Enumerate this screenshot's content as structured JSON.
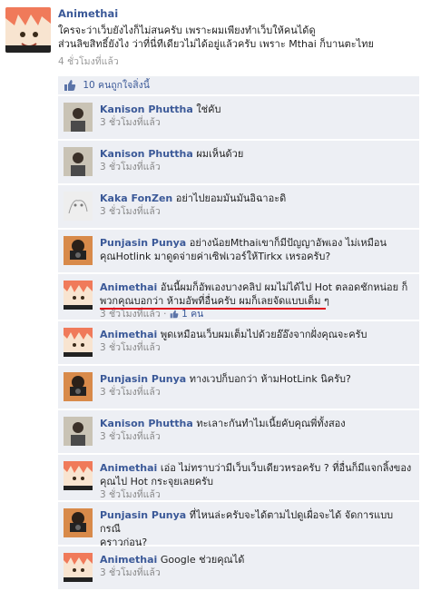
{
  "post": {
    "author": "Animethai",
    "text_line1": "ใครจะว่าเว็บยังไงก็ไม่สนครับ เพราะผมเพียงทำเว็บให้คนได้ดู",
    "text_line2": "ส่วนลิขสิทธิ์ยังไง ว่าที่นี่ทีเดียวไม่ได้อยู่แล้วครับ เพราะ Mthai ก็บานตะไทย",
    "time": "4 ชั่วโมงที่แล้ว"
  },
  "likes": {
    "text": "10 คนถูกใจสิ่งนี้",
    "icon": "thumbs-up-icon"
  },
  "comments": [
    {
      "author": "Kanison Phuttha",
      "text": "ใช่คับ",
      "time": "3 ชั่วโมงที่แล้ว",
      "avatar": "avatar-kanison"
    },
    {
      "author": "Kanison Phuttha",
      "text": "ผมเห็นด้วย",
      "time": "3 ชั่วโมงที่แล้ว",
      "avatar": "avatar-kanison"
    },
    {
      "author": "Kaka FonZen",
      "text": "อย่าไปยอมมันมันอิฉาอะดิ",
      "time": "3 ชั่วโมงที่แล้ว",
      "avatar": "avatar-kaka"
    },
    {
      "author": "Punjasin Punya",
      "text": "อย่างน้อยMthaiเขาก็มีปัญญาอัพเอง ไม่เหมือน",
      "text2": "คุณHotlink มาดูดจ่ายค่าเซิฟเวอร์ให้Tirkx เหรอครับ?",
      "time": "",
      "avatar": "avatar-punjasin"
    },
    {
      "author": "Animethai",
      "text": "อันนี้ผมก็อัพเองบางคลิป ผมไม่ได้ไป Hot ตลอดชักหน่อย ก็",
      "text2": "พวกคุณบอกว่า ห้ามอัพที่อื่นครับ ผมก็เลยจัดแบบเต็ม ๆ",
      "time": "3 ชั่วโมงที่แล้ว",
      "sep": "·",
      "like": "1 คน",
      "avatar": "avatar-animethai"
    },
    {
      "author": "Animethai",
      "text": "พูดเหมือนเว็บผมเต็มไปด้วยอ๊อ๊งจากฝั่งคุณจะครับ",
      "time": "3 ชั่วโมงที่แล้ว",
      "avatar": "avatar-animethai"
    },
    {
      "author": "Punjasin Punya",
      "text": "ทางเวปก็บอกว่า ห้ามHotLink นิครับ?",
      "time": "3 ชั่วโมงที่แล้ว",
      "avatar": "avatar-punjasin"
    },
    {
      "author": "Kanison Phuttha",
      "text": "ทะเลาะกันทำไมเนี้ยคับคุณพี่ทั้งสอง",
      "time": "3 ชั่วโมงที่แล้ว",
      "avatar": "avatar-kanison"
    },
    {
      "author": "Animethai",
      "text": "เอ่อ ไม่ทราบว่ามีเว็บเว็บเดียวหรอครับ ? ที่อื่นก็มีแจกลิ้งของ",
      "text2": "คุณไป Hot กระจุยเลยครับ",
      "time": "3 ชั่วโมงที่แล้ว",
      "avatar": "avatar-animethai"
    },
    {
      "author": "Punjasin Punya",
      "text": "ที่ไหนล่ะครับจะได้ตามไปดูเผื่อจะได้ จัดการแบบกรณี",
      "text2": "คราวก่อน?",
      "time": "",
      "avatar": "avatar-punjasin"
    },
    {
      "author": "Animethai",
      "text": "Google ช่วยคุณได้",
      "time": "3 ชั่วโมงที่แล้ว",
      "avatar": "avatar-animethai"
    }
  ],
  "colors": {
    "link": "#3b5998",
    "comment_bg": "#edeff4",
    "underline": "#e0101c"
  }
}
